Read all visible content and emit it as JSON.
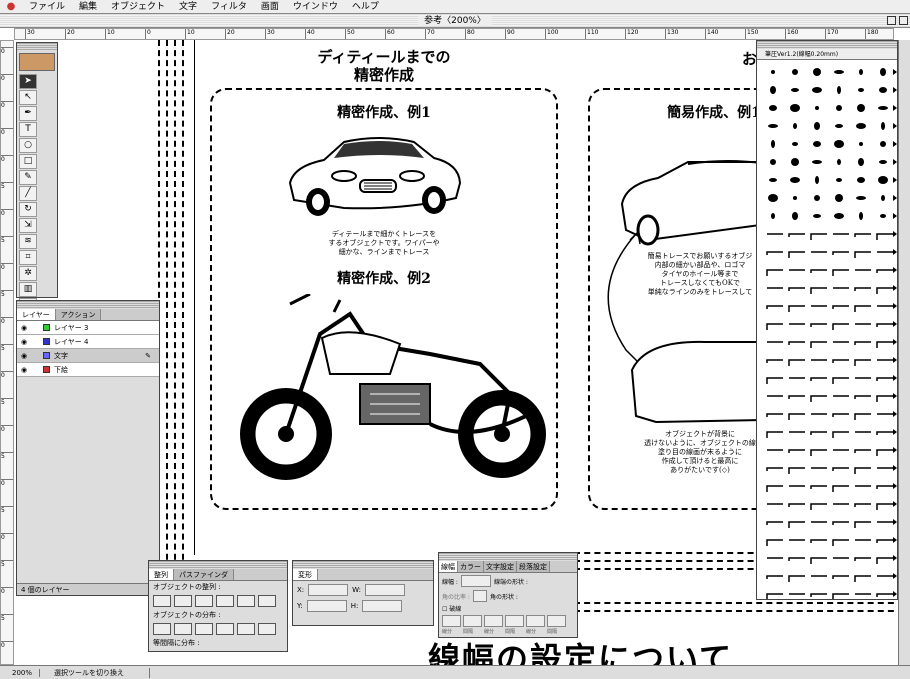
{
  "menubar": {
    "items": [
      "ファイル",
      "編集",
      "オブジェクト",
      "文字",
      "フィルタ",
      "画面",
      "ウインドウ",
      "ヘルプ"
    ]
  },
  "window": {
    "title": "参考〈200%〉"
  },
  "ruler": {
    "h_labels": [
      "30",
      "20",
      "10",
      "0",
      "10",
      "20",
      "30",
      "40",
      "50",
      "60",
      "70",
      "80",
      "90",
      "100",
      "110",
      "120",
      "130",
      "140",
      "150",
      "160",
      "170",
      "180"
    ],
    "v_labels": [
      "0",
      "0",
      "0",
      "0",
      "0",
      "5",
      "0",
      "5",
      "0",
      "5",
      "0",
      "5",
      "0",
      "5",
      "0",
      "5",
      "0",
      "5",
      "0",
      "5",
      "0",
      "5",
      "0"
    ]
  },
  "page": {
    "title_line1": "ディティールまでの",
    "title_line2": "精密作成",
    "right_title_fragment": "お",
    "box1_heading": "精密作成、例1",
    "box1_caption": [
      "ディテールまで細かくトレースを",
      "するオブジェクトです。ワイパーや",
      "細かな、ラインまでトレース"
    ],
    "box1_heading2": "精密作成、例2",
    "box2_heading": "簡易作成、例1",
    "box2_caption1": [
      "簡易トレースでお願いするオブジ",
      "内部の細かい部品や、ロゴマ",
      "タイヤのホイール等まで",
      "トレースしなくてもOKで",
      "単純なラインのみをトレースして"
    ],
    "box2_caption2": [
      "オブジェクトが背景に",
      "透けないように、オブジェクトの線",
      "塗り目の線画が末るように",
      "作成して頂けると最高に",
      "ありがたいです(◇)"
    ],
    "bottom_heading": "線幅の設定について"
  },
  "layers_panel": {
    "tabs": [
      "レイヤー",
      "アクション"
    ],
    "layers": [
      {
        "name": "レイヤー 3",
        "color": "#3c3"
      },
      {
        "name": "レイヤー 4",
        "color": "#33c"
      },
      {
        "name": "文字",
        "color": "#66f",
        "selected": true
      },
      {
        "name": "下絵",
        "color": "#c33"
      }
    ],
    "footer": "4 個のレイヤー"
  },
  "strokes_panel": {
    "title": "筆圧Ver1.2(線幅0.20mm)"
  },
  "align_panel": {
    "tabs": [
      "整列",
      "パスファインダ"
    ],
    "label1": "オブジェクトの整列 :",
    "label2": "オブジェクトの分布 :",
    "label3": "等間隔に分布 :"
  },
  "transform_panel": {
    "tab": "変形",
    "x_label": "X:",
    "y_label": "Y:",
    "w_label": "W:",
    "h_label": "H:"
  },
  "stroke_panel": {
    "tabs": [
      "線幅",
      "カラー",
      "文字設定",
      "段落設定"
    ],
    "weight_label": "線幅 :",
    "cap_label": "線端の形状 :",
    "corner_label": "角の形状 :",
    "limit_label": "角の比率 :",
    "dash_label": "破線",
    "dash_fields": [
      "線分",
      "間隔",
      "線分",
      "間隔",
      "線分",
      "間隔"
    ]
  },
  "statusbar": {
    "zoom": "200%",
    "tool_hint": "選択ツールを切り換え"
  }
}
